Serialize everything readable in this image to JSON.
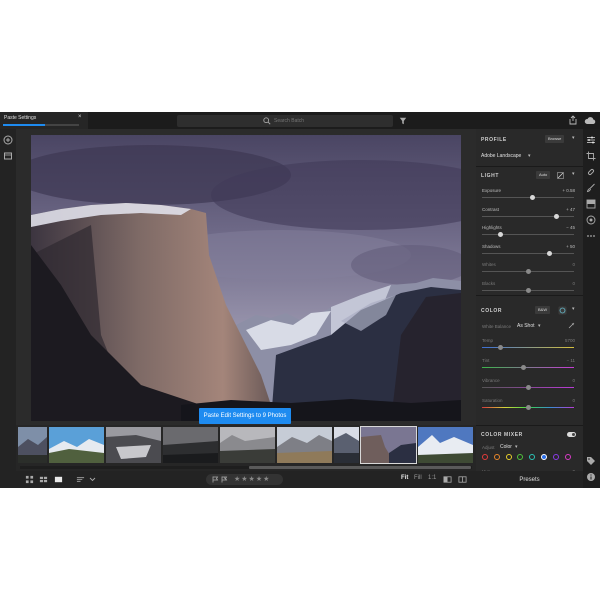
{
  "topbar": {
    "tab_label": "Paste Settings",
    "tab_progress": 0.55,
    "tab_close": "×",
    "search_placeholder": "Search Batch"
  },
  "paste_button": "Paste Edit Settings to 9 Photos",
  "filmstrip": {
    "thumb_count": 9,
    "selected_index": 6
  },
  "bottombar": {
    "stars": "★★★★★",
    "zoom_fit": "Fit",
    "zoom_fill": "Fill",
    "zoom_1to1": "1:1"
  },
  "panel": {
    "profile": {
      "title": "PROFILE",
      "browse": "Browse",
      "value": "Adobe Landscape",
      "chevron": "▾"
    },
    "light": {
      "title": "LIGHT",
      "auto": "Auto",
      "sliders": [
        {
          "label": "Exposure",
          "value": "+ 0.58",
          "pos": 0.55,
          "dim": false
        },
        {
          "label": "Contrast",
          "value": "+ 47",
          "pos": 0.81,
          "dim": false
        },
        {
          "label": "Highlights",
          "value": "− 45",
          "pos": 0.2,
          "dim": false
        },
        {
          "label": "Shadows",
          "value": "+ 50",
          "pos": 0.73,
          "dim": false
        },
        {
          "label": "Whites",
          "value": "0",
          "pos": 0.5,
          "dim": true
        },
        {
          "label": "Blacks",
          "value": "0",
          "pos": 0.5,
          "dim": true
        }
      ]
    },
    "color": {
      "title": "COLOR",
      "bw": "B&W",
      "white_balance_label": "White Balance",
      "white_balance_value": "As Shot",
      "sliders": [
        {
          "label": "Temp",
          "value": "5700",
          "pos": 0.2,
          "dim": true,
          "gradient": "linear-gradient(90deg,#3b6fd6,#d6c13b)"
        },
        {
          "label": "Tint",
          "value": "− 11",
          "pos": 0.45,
          "dim": true,
          "gradient": "linear-gradient(90deg,#3bb54a,#c63bd6)"
        },
        {
          "label": "Vibrance",
          "value": "0",
          "pos": 0.5,
          "dim": true,
          "gradient": "linear-gradient(90deg,#555,#b93bd6)"
        },
        {
          "label": "Saturation",
          "value": "0",
          "pos": 0.5,
          "dim": true,
          "gradient": "linear-gradient(90deg,#d63b3b,#d6d63b,#3bd64a,#3b8bd6,#b93bd6)"
        }
      ]
    },
    "color_mixer": {
      "title": "COLOR MIXER",
      "adjust_label": "Adjust",
      "adjust_value": "Color",
      "hue_label": "Hue",
      "hue_value": "0",
      "swatches": [
        "#e23b3b",
        "#e8862b",
        "#e8d02b",
        "#4fc33b",
        "#2bc3b5",
        "#2b6fe8",
        "#8a3be8",
        "#d83bc6"
      ],
      "selected_swatch": 5
    }
  },
  "presets_label": "Presets",
  "colors": {
    "accent": "#1e8bf0"
  }
}
